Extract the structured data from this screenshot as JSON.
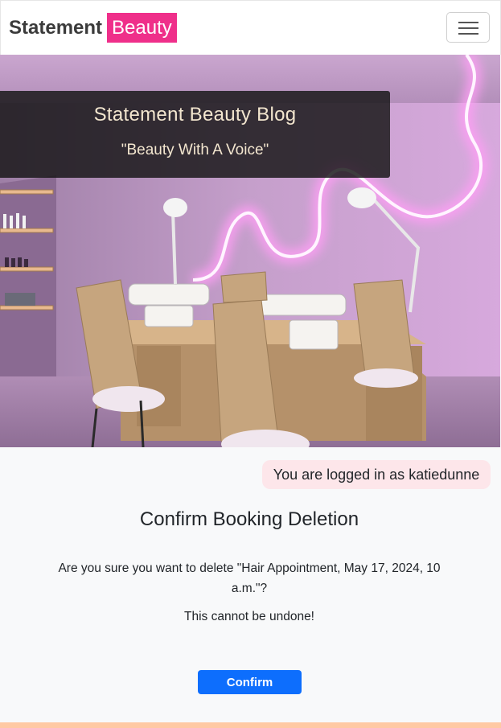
{
  "navbar": {
    "brand_main": "Statement",
    "brand_highlight": "Beauty",
    "toggler_icon": "hamburger-menu-icon"
  },
  "hero": {
    "title": "Statement Beauty Blog",
    "subtitle": "\"Beauty With A Voice\""
  },
  "user_status": {
    "text": "You are logged in as katiedunne"
  },
  "confirm_dialog": {
    "title": "Confirm Booking Deletion",
    "question": "Are you sure you want to delete \"Hair Appointment, May 17, 2024, 10 a.m.\"?",
    "warning": "This cannot be undone!",
    "confirm_label": "Confirm"
  },
  "colors": {
    "brand_pink": "#ef2f8a",
    "primary_blue": "#0d6efd",
    "badge_bg": "#fde6ea",
    "footer_accent": "#ffc9a3"
  }
}
